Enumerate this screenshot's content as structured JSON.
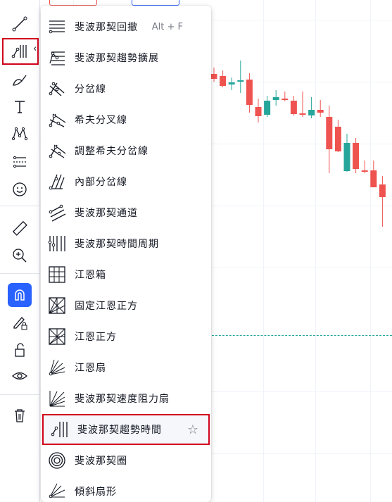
{
  "toolbar": {
    "tools": [
      {
        "name": "trend-line-tool",
        "icon": "trend-line-icon"
      },
      {
        "name": "fib-tool",
        "icon": "fib-trend-time-icon",
        "selected": true
      },
      {
        "name": "brush-tool",
        "icon": "brush-icon"
      },
      {
        "name": "text-tool",
        "icon": "text-icon"
      },
      {
        "name": "pattern-tool",
        "icon": "pattern-icon"
      },
      {
        "name": "prediction-tool",
        "icon": "long-short-icon"
      },
      {
        "name": "emoji-tool",
        "icon": "smiley-icon"
      },
      {
        "name": "measure-tool",
        "icon": "ruler-icon"
      },
      {
        "name": "zoom-tool",
        "icon": "zoom-in-icon"
      },
      {
        "name": "magnet-tool",
        "icon": "magnet-icon",
        "active": true
      },
      {
        "name": "lock-drawing-tool",
        "icon": "pencil-lock-icon"
      },
      {
        "name": "lock-all-tool",
        "icon": "unlock-icon"
      },
      {
        "name": "hide-tool",
        "icon": "eye-icon"
      },
      {
        "name": "remove-tool",
        "icon": "trash-icon"
      }
    ],
    "chevron": "‹",
    "highlight_color": "#d0021b",
    "active_color": "#2962ff"
  },
  "menu": {
    "items": [
      {
        "label": "斐波那契回撤",
        "icon": "fib-retracement-icon",
        "shortcut": "Alt + F"
      },
      {
        "label": "斐波那契趨勢擴展",
        "icon": "fib-trend-extension-icon"
      },
      {
        "label": "分岔線",
        "icon": "pitchfork-icon"
      },
      {
        "label": "希夫分叉線",
        "icon": "schiff-pitchfork-icon"
      },
      {
        "label": "調整希夫分岔線",
        "icon": "modified-schiff-pitchfork-icon"
      },
      {
        "label": "內部分岔線",
        "icon": "inside-pitchfork-icon"
      },
      {
        "label": "斐波那契通道",
        "icon": "fib-channel-icon"
      },
      {
        "label": "斐波那契時間周期",
        "icon": "fib-time-zone-icon"
      },
      {
        "label": "江恩箱",
        "icon": "gann-box-icon"
      },
      {
        "label": "固定江恩正方",
        "icon": "gann-square-fixed-icon"
      },
      {
        "label": "江恩正方",
        "icon": "gann-square-icon"
      },
      {
        "label": "江恩扇",
        "icon": "gann-fan-icon"
      },
      {
        "label": "斐波那契速度阻力扇",
        "icon": "fib-speed-fan-icon"
      },
      {
        "label": "斐波那契趨勢時間",
        "icon": "fib-trend-time-icon",
        "highlighted": true,
        "favorite_icon": "star-outline-icon",
        "star": "☆"
      },
      {
        "label": "斐波那契圈",
        "icon": "fib-circles-icon"
      },
      {
        "label": "傾斜扇形",
        "icon": "fib-wedge-icon"
      }
    ]
  },
  "chart": {
    "up_color": "#26a69a",
    "down_color": "#ef5350",
    "candles": [
      {
        "o": 105,
        "h": 96,
        "l": 116,
        "c": 112,
        "dir": "down"
      },
      {
        "o": 108,
        "h": 100,
        "l": 124,
        "c": 122,
        "dir": "down"
      },
      {
        "o": 120,
        "h": 110,
        "l": 128,
        "c": 117,
        "dir": "up"
      },
      {
        "o": 116,
        "h": 86,
        "l": 132,
        "c": 114,
        "dir": "up"
      },
      {
        "o": 113,
        "h": 104,
        "l": 160,
        "c": 149,
        "dir": "down"
      },
      {
        "o": 152,
        "h": 140,
        "l": 174,
        "c": 165,
        "dir": "down"
      },
      {
        "o": 163,
        "h": 136,
        "l": 166,
        "c": 143,
        "dir": "up"
      },
      {
        "o": 142,
        "h": 128,
        "l": 150,
        "c": 138,
        "dir": "up"
      },
      {
        "o": 140,
        "h": 130,
        "l": 144,
        "c": 141,
        "dir": "down"
      },
      {
        "o": 143,
        "h": 136,
        "l": 164,
        "c": 162,
        "dir": "down"
      },
      {
        "o": 161,
        "h": 130,
        "l": 166,
        "c": 162,
        "dir": "down"
      },
      {
        "o": 164,
        "h": 138,
        "l": 168,
        "c": 156,
        "dir": "up"
      },
      {
        "o": 156,
        "h": 142,
        "l": 166,
        "c": 160,
        "dir": "down"
      },
      {
        "o": 166,
        "h": 150,
        "l": 246,
        "c": 212,
        "dir": "down"
      },
      {
        "o": 180,
        "h": 170,
        "l": 216,
        "c": 215,
        "dir": "down"
      },
      {
        "o": 243,
        "h": 190,
        "l": 244,
        "c": 203,
        "dir": "up"
      },
      {
        "o": 203,
        "h": 196,
        "l": 246,
        "c": 240,
        "dir": "down"
      },
      {
        "o": 242,
        "h": 228,
        "l": 246,
        "c": 244,
        "dir": "down"
      },
      {
        "o": 242,
        "h": 228,
        "l": 256,
        "c": 266,
        "dir": "down"
      },
      {
        "o": 262,
        "h": 250,
        "l": 322,
        "c": 280,
        "dir": "down"
      }
    ]
  }
}
